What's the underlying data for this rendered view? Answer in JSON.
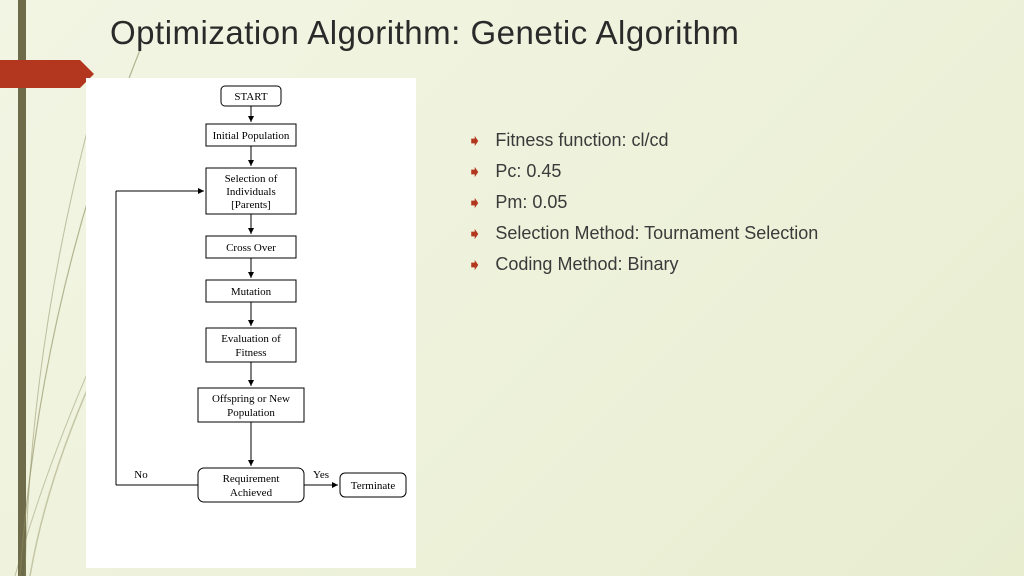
{
  "title": "Optimization Algorithm: Genetic Algorithm",
  "flowchart": {
    "start": "START",
    "initial": "Initial Population",
    "selection_l1": "Selection of",
    "selection_l2": "Individuals",
    "selection_l3": "[Parents]",
    "crossover": "Cross Over",
    "mutation": "Mutation",
    "eval_l1": "Evaluation of",
    "eval_l2": "Fitness",
    "offspring_l1": "Offspring or New",
    "offspring_l2": "Population",
    "req_l1": "Requirement",
    "req_l2": "Achieved",
    "terminate": "Terminate",
    "no": "No",
    "yes": "Yes"
  },
  "bullets": [
    "Fitness function: cl/cd",
    "Pc: 0.45",
    "Pm: 0.05",
    "Selection Method: Tournament Selection",
    "Coding Method: Binary"
  ]
}
